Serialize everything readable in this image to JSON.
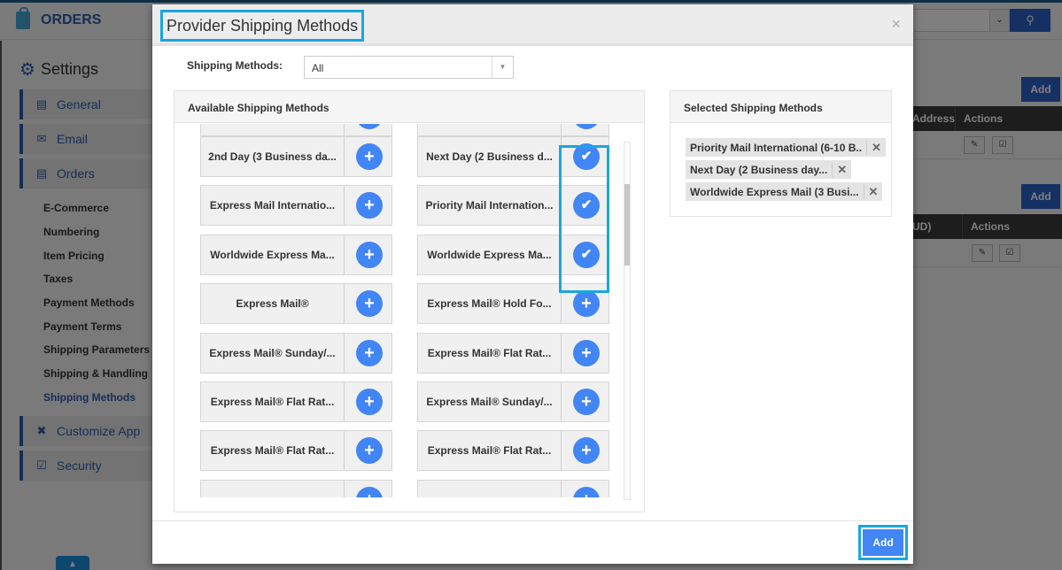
{
  "app": {
    "title": "ORDERS",
    "header_select_value": "",
    "search_icon": "search-icon"
  },
  "sidebar": {
    "section_title": "Settings",
    "items": [
      {
        "label": "General",
        "icon": "monitor-icon"
      },
      {
        "label": "Email",
        "icon": "envelope-open-icon"
      },
      {
        "label": "Orders",
        "icon": "orders-icon"
      }
    ],
    "sub_items": [
      {
        "label": "E-Commerce",
        "active": false
      },
      {
        "label": "Numbering",
        "active": false
      },
      {
        "label": "Item Pricing",
        "active": false
      },
      {
        "label": "Taxes",
        "active": false
      },
      {
        "label": "Payment Methods",
        "active": false
      },
      {
        "label": "Payment Terms",
        "active": false
      },
      {
        "label": "Shipping Parameters",
        "active": false
      },
      {
        "label": "Shipping & Handling",
        "active": false
      },
      {
        "label": "Shipping Methods",
        "active": true
      }
    ],
    "bottom_items": [
      {
        "label": "Customize App",
        "icon": "tools-icon"
      },
      {
        "label": "Security",
        "icon": "lock-icon"
      }
    ]
  },
  "background": {
    "add_label": "Add",
    "table1_headers": [
      "Address",
      "Actions"
    ],
    "table2_headers": [
      "UD)",
      "Actions"
    ]
  },
  "modal": {
    "title": "Provider Shipping Methods",
    "close_label": "×",
    "filter": {
      "label": "Shipping Methods:",
      "value": "All"
    },
    "available": {
      "heading": "Available Shipping Methods",
      "left_column": [
        {
          "name": "",
          "state": "add"
        },
        {
          "name": "2nd Day (3 Business da...",
          "state": "add"
        },
        {
          "name": "Express Mail Internatio...",
          "state": "add"
        },
        {
          "name": "Worldwide Express Ma...",
          "state": "add"
        },
        {
          "name": "Express Mail®",
          "state": "add"
        },
        {
          "name": "Express Mail® Sunday/...",
          "state": "add"
        },
        {
          "name": "Express Mail® Flat Rat...",
          "state": "add"
        },
        {
          "name": "Express Mail® Flat Rat...",
          "state": "add"
        },
        {
          "name": "",
          "state": "add"
        }
      ],
      "right_column": [
        {
          "name": "",
          "state": "add"
        },
        {
          "name": "Next Day (2 Business d...",
          "state": "selected"
        },
        {
          "name": "Priority Mail Internation...",
          "state": "selected"
        },
        {
          "name": "Worldwide Express Ma...",
          "state": "selected"
        },
        {
          "name": "Express Mail® Hold Fo...",
          "state": "add"
        },
        {
          "name": "Express Mail® Flat Rat...",
          "state": "add"
        },
        {
          "name": "Express Mail® Sunday/...",
          "state": "add"
        },
        {
          "name": "Express Mail® Flat Rat...",
          "state": "add"
        },
        {
          "name": "",
          "state": "add"
        }
      ],
      "scroll_position": 0.15
    },
    "selected": {
      "heading": "Selected Shipping Methods",
      "tags": [
        "Priority Mail International (6-10 B..",
        "Next Day (2 Business day...",
        "Worldwide Express Mail (3 Busi..."
      ],
      "remove_label": "✕"
    },
    "footer": {
      "add_label": "Add"
    }
  },
  "colors": {
    "accent": "#4285f4",
    "brand": "#2a5caa",
    "highlight": "#1aa6e0"
  }
}
